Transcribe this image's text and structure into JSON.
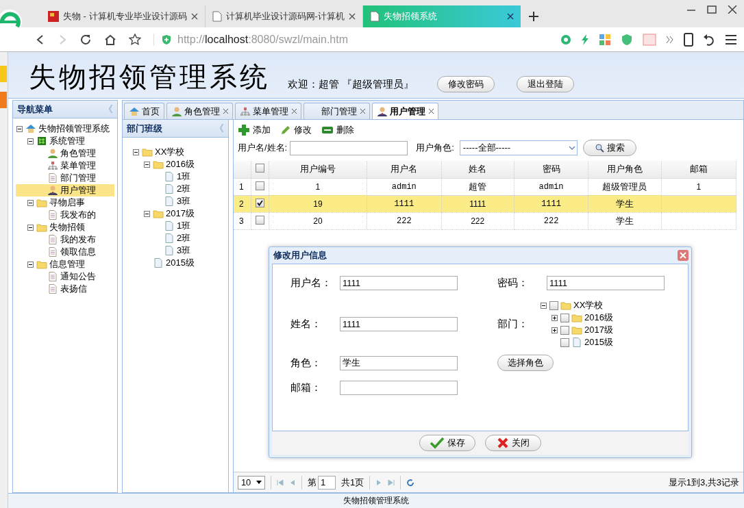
{
  "browser": {
    "tabs": [
      {
        "title": "失物 - 计算机专业毕业设计源码",
        "kind": "flag",
        "selected": false
      },
      {
        "title": "计算机毕业设计源码网-计算机",
        "kind": "doc",
        "selected": false
      },
      {
        "title": "失物招领系统",
        "kind": "doc",
        "selected": true
      }
    ],
    "url": "http://**localhost**:8080/swzl/main.htm"
  },
  "header": {
    "title": "失物招领管理系统",
    "welcome": "欢迎：超管 『超级管理员』",
    "buttons": [
      "修改密码",
      "退出登陆"
    ]
  },
  "nav": {
    "title": "导航菜单",
    "collapse": "《",
    "tree": [
      {
        "label": "失物招领管理系统",
        "kind": "home",
        "expanded": true,
        "selected": false,
        "children": [
          {
            "label": "系统管理",
            "kind": "grid",
            "expanded": true,
            "selected": false,
            "children": [
              {
                "label": "角色管理",
                "kind": "user",
                "selected": false
              },
              {
                "label": "菜单管理",
                "kind": "org",
                "selected": false
              },
              {
                "label": "部门管理",
                "kind": "doc",
                "selected": false
              },
              {
                "label": "用户管理",
                "kind": "manager",
                "selected": true
              }
            ]
          },
          {
            "label": "寻物启事",
            "kind": "folder",
            "expanded": true,
            "selected": false,
            "children": [
              {
                "label": "我发布的",
                "kind": "doc",
                "selected": false
              }
            ]
          },
          {
            "label": "失物招领",
            "kind": "folder",
            "expanded": true,
            "selected": false,
            "children": [
              {
                "label": "我的发布",
                "kind": "doc",
                "selected": false
              },
              {
                "label": "领取信息",
                "kind": "doc",
                "selected": false
              }
            ]
          },
          {
            "label": "信息管理",
            "kind": "folder",
            "expanded": true,
            "selected": false,
            "children": [
              {
                "label": "通知公告",
                "kind": "doc",
                "selected": false
              },
              {
                "label": "表扬信",
                "kind": "doc",
                "selected": false
              }
            ]
          }
        ]
      }
    ]
  },
  "content_tabs": [
    {
      "label": "首页",
      "kind": "home",
      "closable": false,
      "selected": false
    },
    {
      "label": "角色管理",
      "kind": "user",
      "closable": true,
      "selected": false
    },
    {
      "label": "菜单管理",
      "kind": "org",
      "closable": true,
      "selected": false
    },
    {
      "label": "部门管理",
      "kind": "none",
      "closable": true,
      "selected": false
    },
    {
      "label": "用户管理",
      "kind": "manager",
      "closable": true,
      "selected": true
    }
  ],
  "dept_panel": {
    "title": "部门班级",
    "collapse": "《",
    "tree": [
      {
        "label": "XX学校",
        "kind": "folder",
        "expanded": true,
        "children": [
          {
            "label": "2016级",
            "kind": "folder",
            "expanded": true,
            "children": [
              {
                "label": "1班",
                "kind": "file"
              },
              {
                "label": "2班",
                "kind": "file"
              },
              {
                "label": "3班",
                "kind": "file"
              }
            ]
          },
          {
            "label": "2017级",
            "kind": "folder",
            "expanded": true,
            "children": [
              {
                "label": "1班",
                "kind": "file"
              },
              {
                "label": "2班",
                "kind": "file"
              },
              {
                "label": "3班",
                "kind": "file"
              }
            ]
          },
          {
            "label": "2015级",
            "kind": "file"
          }
        ]
      }
    ]
  },
  "toolbar": [
    {
      "label": "添加",
      "kind": "add"
    },
    {
      "label": "修改",
      "kind": "edit"
    },
    {
      "label": "删除",
      "kind": "remove"
    }
  ],
  "search": {
    "name_label": "用户名/姓名:",
    "role_label": "用户角色:",
    "role_value": "-----全部-----",
    "button": "搜索"
  },
  "table": {
    "columns": [
      "用户编号",
      "用户名",
      "姓名",
      "密码",
      "用户角色",
      "邮箱"
    ],
    "all_checked": false,
    "rows": [
      {
        "number": "1",
        "checked": false,
        "selected": false,
        "id": "1",
        "username": "admin",
        "name": "超管",
        "password": "admin",
        "role": "超级管理员",
        "email": "1"
      },
      {
        "number": "2",
        "checked": true,
        "selected": true,
        "id": "19",
        "username": "1111",
        "name": "1111",
        "password": "1111",
        "role": "学生"
      },
      {
        "number": "3",
        "checked": false,
        "selected": false,
        "id": "20",
        "username": "222",
        "name": "222",
        "password": "222",
        "role": "学生"
      }
    ]
  },
  "pager": {
    "page_size": "10",
    "page_prefix": "第",
    "page": "1",
    "page_total": "共1页",
    "summary": "显示1到3,共3记录"
  },
  "dialog": {
    "title": "修改用户信息",
    "username_label": "用户名：",
    "username": "1111",
    "password_label": "密码：",
    "password": "1111",
    "name_label": "姓名：",
    "name": "1111",
    "dept_label": "部门：",
    "dept_tree": [
      {
        "label": "XX学校",
        "kind": "folder",
        "expanded": true,
        "checked": false,
        "children": [
          {
            "label": "2016级",
            "kind": "folder",
            "expanded": false,
            "checked": false
          },
          {
            "label": "2017级",
            "kind": "folder",
            "expanded": false,
            "checked": false
          },
          {
            "label": "2015级",
            "kind": "file",
            "checked": false
          }
        ]
      }
    ],
    "role_label": "角色：",
    "role": "学生",
    "role_button": "选择角色",
    "email_label": "邮箱：",
    "buttons": [
      {
        "label": "保存",
        "kind": "check"
      },
      {
        "label": "关闭",
        "kind": "cross"
      }
    ]
  },
  "footer": "失物招领管理系统"
}
